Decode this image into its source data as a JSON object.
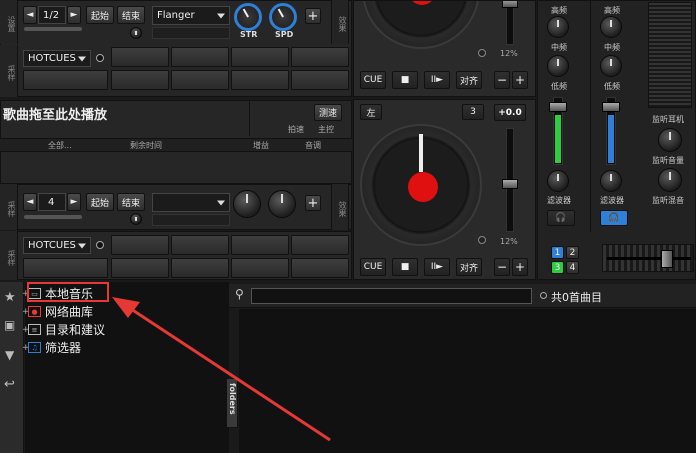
{
  "deck1": {
    "side_label_top": "设置",
    "side_label_mid": "采样",
    "pitch_step": "1/2",
    "begin_label": "起始",
    "end_label": "结束",
    "effect_name": "Flanger",
    "knob_str": "STR",
    "knob_spd": "SPD",
    "side_fx": "效果",
    "hotcues_label": "HOTCUES",
    "pitch_percent": "12%",
    "cue_label": "CUE",
    "stop_icon": "■",
    "play_icon": "II►",
    "sync_label": "对齐"
  },
  "deck2": {
    "track_title": "歌曲拖至此处播放",
    "bpm_btn": "测速",
    "beat_label": "拍速",
    "master_label": "主控",
    "col_all": "全部...",
    "col_remaining": "剩余时间",
    "col_gain": "增益",
    "col_key": "音调",
    "left_btn": "左",
    "deck_num": "3",
    "pitch_value": "+0.0",
    "loop_num": "4",
    "begin_label": "起始",
    "end_label": "结束",
    "hotcues_label": "HOTCUES",
    "pitch_percent": "12%",
    "cue_label": "CUE",
    "stop_icon": "■",
    "play_icon": "II►",
    "sync_label": "对齐",
    "side_fx": "效果",
    "side_sample": "采样"
  },
  "mixer": {
    "high1": "高频",
    "mid1": "中频",
    "low1": "低频",
    "filter1": "滤波器",
    "high2": "高频",
    "mid2": "中频",
    "low2": "低频",
    "filter2": "滤波器",
    "headphone_label": "监听耳机",
    "headphone_vol": "监听音量",
    "headphone_mix": "监听混音",
    "deck_1": "1",
    "deck_2": "2",
    "deck_3": "3",
    "deck_4": "4"
  },
  "browser": {
    "tree": [
      {
        "label": "本地音乐"
      },
      {
        "label": "网络曲库"
      },
      {
        "label": "目录和建议"
      },
      {
        "label": "筛选器"
      }
    ],
    "folders_tab": "folders",
    "search_placeholder": "",
    "count_text": "共0首曲目"
  },
  "colors": {
    "highlight": "#e53935",
    "accent_blue": "#2f7fd6",
    "green_meter": "#2ecc40"
  }
}
